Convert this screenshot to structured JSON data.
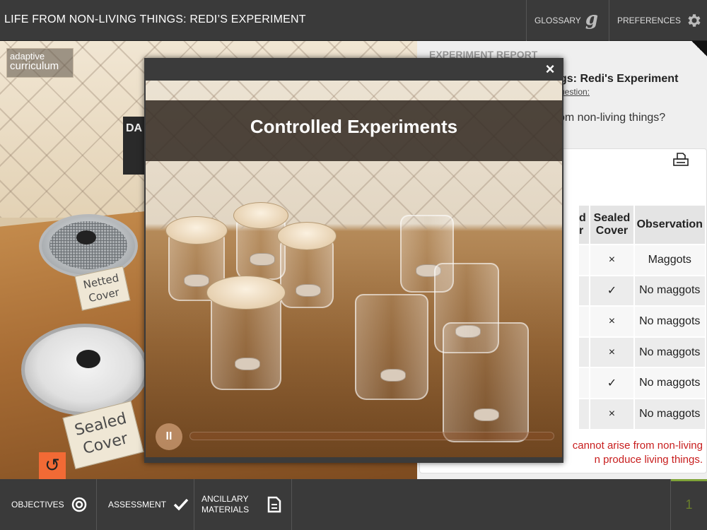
{
  "header": {
    "title": "LIFE FROM NON-LIVING THINGS: REDI’S EXPERIMENT",
    "glossary_label": "GLOSSARY",
    "glossary_glyph": "g",
    "preferences_label": "PREFERENCES"
  },
  "scene": {
    "logo_line1": "adaptive",
    "logo_line2": "curriculum",
    "sign_text": "DA",
    "card_netted": "Netted Cover",
    "card_sealed": "Sealed Cover",
    "restart_glyph": "↺"
  },
  "report": {
    "heading": "EXPERIMENT REPORT",
    "title": "gs: Redi's Experiment",
    "subtitle": "uestion:",
    "question": "om non-living things?",
    "columns": [
      "d\nr",
      "Sealed Cover",
      "Observation"
    ],
    "rows": [
      {
        "sealed": "×",
        "observation": "Maggots"
      },
      {
        "sealed": "✓",
        "observation": "No maggots"
      },
      {
        "sealed": "×",
        "observation": "No maggots"
      },
      {
        "sealed": "×",
        "observation": "No maggots"
      },
      {
        "sealed": "✓",
        "observation": "No maggots"
      },
      {
        "sealed": "×",
        "observation": "No maggots"
      }
    ],
    "conclusion_line1": "cannot arise from non-living",
    "conclusion_line2": "n produce living things."
  },
  "video": {
    "close_glyph": "×",
    "title": "Controlled Experiments",
    "pause_glyph": "II",
    "progress": 0.0
  },
  "footer": {
    "objectives_label": "OBJECTIVES",
    "assessment_label": "ASSESSMENT",
    "ancillary_line1": "ANCILLARY",
    "ancillary_line2": "MATERIALS",
    "page_number": "1"
  },
  "colors": {
    "accent_orange": "#f26a35",
    "conclusion_red": "#c81e1e",
    "page_green": "#7fa338"
  }
}
